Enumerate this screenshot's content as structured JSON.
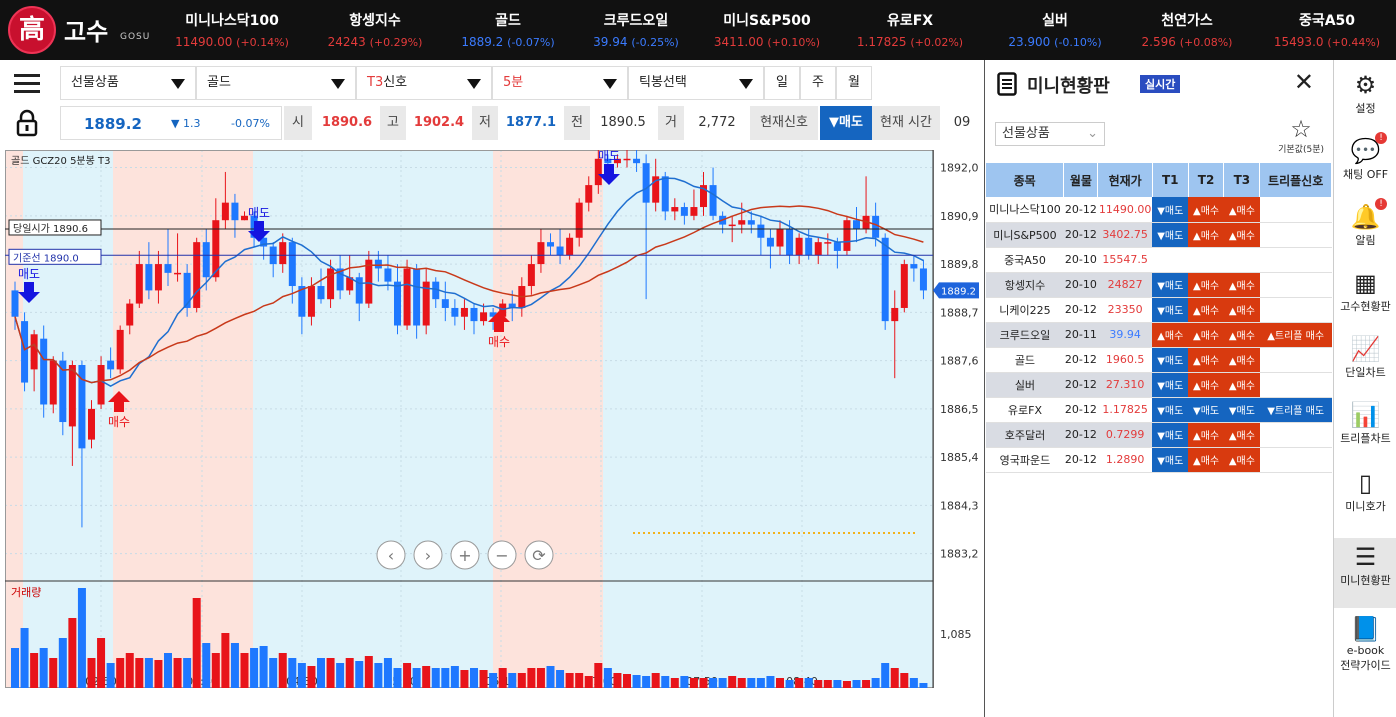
{
  "logo": {
    "glyph": "高",
    "name": "고수",
    "sub": "GOSU"
  },
  "tickers": [
    {
      "name": "미니나스닥100",
      "value": "11490.00",
      "change": "(+0.14%)",
      "dir": "up"
    },
    {
      "name": "항셍지수",
      "value": "24243",
      "change": "(+0.29%)",
      "dir": "up"
    },
    {
      "name": "골드",
      "value": "1889.2",
      "change": "(-0.07%)",
      "dir": "dn"
    },
    {
      "name": "크루드오일",
      "value": "39.94",
      "change": "(-0.25%)",
      "dir": "dn"
    },
    {
      "name": "미니S&P500",
      "value": "3411.00",
      "change": "(+0.10%)",
      "dir": "up"
    },
    {
      "name": "유로FX",
      "value": "1.17825",
      "change": "(+0.02%)",
      "dir": "up"
    },
    {
      "name": "실버",
      "value": "23.900",
      "change": "(-0.10%)",
      "dir": "dn"
    },
    {
      "name": "천연가스",
      "value": "2.596",
      "change": "(+0.08%)",
      "dir": "up"
    },
    {
      "name": "중국A50",
      "value": "15493.0",
      "change": "(+0.44%)",
      "dir": "up"
    }
  ],
  "toolbar": {
    "product": "선물상품",
    "item": "골드",
    "signal_prefix": "T3",
    "signal_suffix": "신호",
    "interval": "5분",
    "candle": "틱봉선택",
    "day": "일",
    "week": "주",
    "month": "월"
  },
  "quote": {
    "price": "1889.2",
    "chg": "▼ 1.3",
    "pct": "-0.07%",
    "open_lbl": "시",
    "open": "1890.6",
    "high_lbl": "고",
    "high": "1902.4",
    "low_lbl": "저",
    "low": "1877.1",
    "prev_lbl": "전",
    "prev": "1890.5",
    "vol_lbl": "거",
    "vol": "2,772",
    "signal_lbl": "현재신호",
    "signal": "▼매도",
    "time_lbl": "현재 시간",
    "time": "09"
  },
  "chart_labels": {
    "header": "골드  GCZ20  5분봉  T3",
    "open_line": "당일시가 1890.6",
    "base_line": "기준선 1890.0",
    "volume": "거래량",
    "price_tag": "1889.2",
    "vol_tick": "1,085",
    "buy": "매수",
    "sell": "매도"
  },
  "chart_data": {
    "type": "candlestick",
    "yticks": [
      "1892,0",
      "1890,9",
      "1889,8",
      "1888,7",
      "1887,6",
      "1886,5",
      "1885,4",
      "1884,3",
      "1883,2"
    ],
    "xticks": [
      "02:50",
      "03:40",
      "04:30",
      "05:20",
      "06:10",
      "07:00",
      "07:50",
      "08:40"
    ],
    "ylim": [
      1882.6,
      1892.4
    ],
    "open_price": 1890.6,
    "base_price": 1890.0,
    "last_price": 1889.2
  },
  "panel": {
    "title": "미니현황판",
    "live": "실시간",
    "select": "선물상품",
    "star_lbl": "기본값(5분)",
    "headers": [
      "종목",
      "월물",
      "현재가",
      "T1",
      "T2",
      "T3",
      "트리플신호"
    ],
    "rows": [
      {
        "name": "미니나스닥100",
        "mo": "20-12",
        "price": "11490.00",
        "pc": "up",
        "t1": "▼매도",
        "t2": "▲매수",
        "t3": "▲매수",
        "tr": ""
      },
      {
        "name": "미니S&P500",
        "mo": "20-12",
        "price": "3402.75",
        "pc": "up",
        "t1": "▼매도",
        "t2": "▲매수",
        "t3": "▲매수",
        "tr": ""
      },
      {
        "name": "중국A50",
        "mo": "20-10",
        "price": "15547.5",
        "pc": "up",
        "t1": "",
        "t2": "",
        "t3": "",
        "tr": ""
      },
      {
        "name": "항셍지수",
        "mo": "20-10",
        "price": "24827",
        "pc": "up",
        "t1": "▼매도",
        "t2": "▲매수",
        "t3": "▲매수",
        "tr": ""
      },
      {
        "name": "니케이225",
        "mo": "20-12",
        "price": "23350",
        "pc": "up",
        "t1": "▼매도",
        "t2": "▲매수",
        "t3": "▲매수",
        "tr": ""
      },
      {
        "name": "크루드오일",
        "mo": "20-11",
        "price": "39.94",
        "pc": "dn",
        "t1": "▲매수",
        "t2": "▲매수",
        "t3": "▲매수",
        "tr": "▲트리플 매수"
      },
      {
        "name": "골드",
        "mo": "20-12",
        "price": "1960.5",
        "pc": "up",
        "t1": "▼매도",
        "t2": "▲매수",
        "t3": "▲매수",
        "tr": ""
      },
      {
        "name": "실버",
        "mo": "20-12",
        "price": "27.310",
        "pc": "up",
        "t1": "▼매도",
        "t2": "▲매수",
        "t3": "▲매수",
        "tr": ""
      },
      {
        "name": "유로FX",
        "mo": "20-12",
        "price": "1.17825",
        "pc": "up",
        "t1": "▼매도",
        "t2": "▼매도",
        "t3": "▼매도",
        "tr": "▼트리플 매도"
      },
      {
        "name": "호주달러",
        "mo": "20-12",
        "price": "0.7299",
        "pc": "up",
        "t1": "▼매도",
        "t2": "▲매수",
        "t3": "▲매수",
        "tr": ""
      },
      {
        "name": "영국파운드",
        "mo": "20-12",
        "price": "1.2890",
        "pc": "up",
        "t1": "▼매도",
        "t2": "▲매수",
        "t3": "▲매수",
        "tr": ""
      }
    ]
  },
  "side": [
    {
      "label": "설정",
      "icon": "gear-icon"
    },
    {
      "label": "채팅 OFF",
      "icon": "chat-icon"
    },
    {
      "label": "알림",
      "icon": "bell-icon"
    },
    {
      "label": "고수현황판",
      "icon": "grid-icon"
    },
    {
      "label": "단일차트",
      "icon": "line-chart-icon"
    },
    {
      "label": "트리플차트",
      "icon": "bar-chart-icon"
    },
    {
      "label": "미니호가",
      "icon": "tablet-icon"
    },
    {
      "label": "미니현황판",
      "icon": "list-icon"
    },
    {
      "label": "e-book",
      "label2": "전략가이드",
      "icon": "book-icon"
    }
  ]
}
